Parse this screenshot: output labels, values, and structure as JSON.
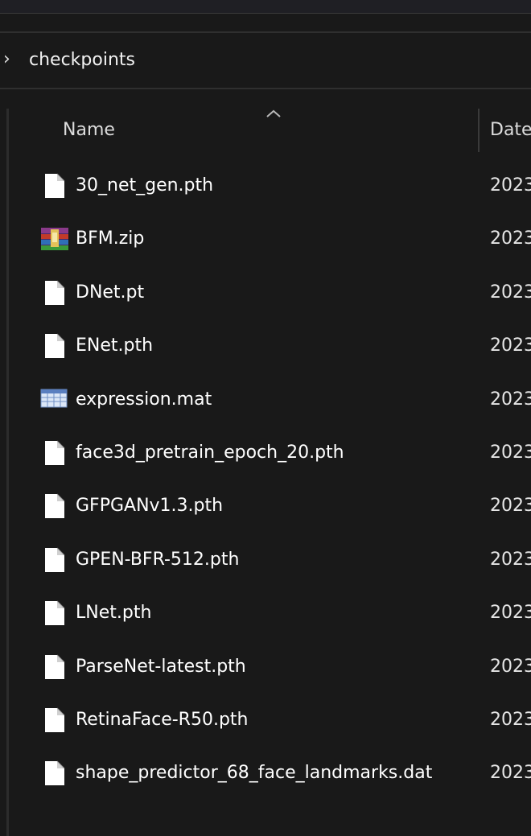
{
  "breadcrumb": {
    "chevron": "›",
    "folder": "checkpoints"
  },
  "header": {
    "name_label": "Name",
    "date_label": "Date",
    "sort_icon": "sort-ascending-caret-icon"
  },
  "files": [
    {
      "name": "30_net_gen.pth",
      "date": "2023",
      "icon": "generic-file-icon"
    },
    {
      "name": "BFM.zip",
      "date": "2023",
      "icon": "winrar-archive-icon"
    },
    {
      "name": "DNet.pt",
      "date": "2023",
      "icon": "generic-file-icon"
    },
    {
      "name": "ENet.pth",
      "date": "2023",
      "icon": "generic-file-icon"
    },
    {
      "name": "expression.mat",
      "date": "2023",
      "icon": "spreadsheet-icon"
    },
    {
      "name": "face3d_pretrain_epoch_20.pth",
      "date": "2023",
      "icon": "generic-file-icon"
    },
    {
      "name": "GFPGANv1.3.pth",
      "date": "2023",
      "icon": "generic-file-icon"
    },
    {
      "name": "GPEN-BFR-512.pth",
      "date": "2023",
      "icon": "generic-file-icon"
    },
    {
      "name": "LNet.pth",
      "date": "2023",
      "icon": "generic-file-icon"
    },
    {
      "name": "ParseNet-latest.pth",
      "date": "2023",
      "icon": "generic-file-icon"
    },
    {
      "name": "RetinaFace-R50.pth",
      "date": "2023",
      "icon": "generic-file-icon"
    },
    {
      "name": "shape_predictor_68_face_landmarks.dat",
      "date": "2023",
      "icon": "generic-file-icon"
    }
  ]
}
